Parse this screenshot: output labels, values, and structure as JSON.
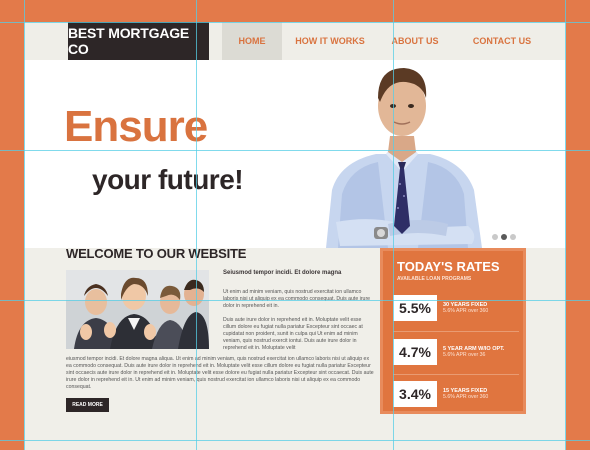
{
  "header": {
    "logo": "BEST MORTGAGE CO",
    "nav": [
      {
        "label": "HOME",
        "active": true
      },
      {
        "label": "HOW IT WORKS",
        "active": false
      },
      {
        "label": "ABOUT US",
        "active": false
      },
      {
        "label": "CONTACT US",
        "active": false
      }
    ]
  },
  "hero": {
    "title": "Ensure",
    "subtitle": "your future!",
    "slides": 3,
    "active_slide": 2
  },
  "welcome": {
    "heading": "WELCOME TO OUR WEBSITE",
    "lead": "Seiusmod tempor incidi. Et dolore magna",
    "para1": "Ut enim ad minim veniam, quis nostrud exercitat ion ullamco laboris nisi ut aliquip ex ea commodo consequat. Duis aute irure dolor in reprehend eit in.",
    "para2": "Duis aute irure dolor in reprehend eit in. Moluptate velit esse cillum dolore eu fugiat nulla pariatur Excepteur sint occaec at cupidatat non proident, sunit in culpa qui Ut enim ad minim veniam, quis nostrud exercit iontui. Duis aute irure dolor in reprehend eit in. Moluptate velit",
    "para3": "eiusmod tempor incidi. Et dolore magna aliqua. Ut enim ad minim veniam, quis nostrud exercitat ion ullamco laboris nisi ut aliquip ex ea commodo consequat. Duis aute irure dolor in reprehend eit in. Moluptate velit esse cillum dolore eu fugiat nulla pariatur Excepteur sint occaecis aute irure dolor in reprehend eit in. Moluptate velit esse dolore eu fugiat nulla pariatur Excepteur sint occaecat. Duis aute irure dolor in reprehend eit in. Ut enim ad minim veniam, quis nostrud exercitat ion ullamco laboris nisi ut aliquip ex ea commodo consequat.",
    "read_more": "READ MORE"
  },
  "rates": {
    "title": "TODAY'S RATES",
    "subtitle": "AVAILABLE LOAN PROGRAMS",
    "items": [
      {
        "rate": "5.5%",
        "label": "30 YEARS FIXED",
        "apr": "5.6% APR over 360"
      },
      {
        "rate": "4.7%",
        "label": "5 YEAR ARM W/IO OPT.",
        "apr": "5.6% APR over 36"
      },
      {
        "rate": "3.4%",
        "label": "15 YEARS FIXED",
        "apr": "5.6% APR over 360"
      }
    ]
  },
  "colors": {
    "accent": "#e37a4a",
    "dark": "#2d2627",
    "background": "#f0efe9"
  }
}
